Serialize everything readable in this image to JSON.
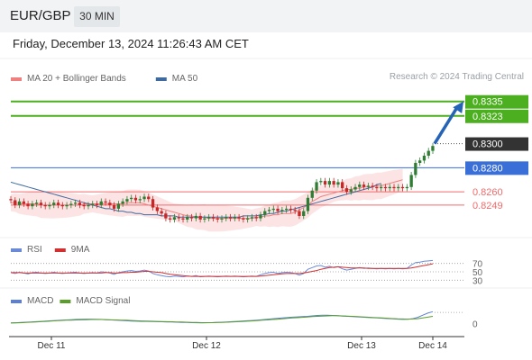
{
  "header": {
    "symbol": "EUR/GBP",
    "timeframe": "30 MIN"
  },
  "datetime": "Friday, December 13, 2024 11:26:43 AM CET",
  "credit": "Research © 2024 Trading Central",
  "colors": {
    "bull": "#2e7d32",
    "bear": "#c62828",
    "ma20": "#f08080",
    "ma50": "#3f6aa1",
    "target": "#4caf1f",
    "pivot": "#3a6fd8",
    "support": "#f06b6b",
    "current": "#333333",
    "rsi": "#6a8ad8",
    "rsi_ma": "#d32f2f",
    "macd": "#5c7fd6",
    "macd_signal": "#5a9e2a",
    "arrow": "#2463b5"
  },
  "icons": {
    "trend_arrow": "arrow-up-right-icon"
  },
  "chart_data": [
    {
      "type": "candlestick",
      "name": "price",
      "ylim": [
        0.8225,
        0.834
      ],
      "legend": [
        {
          "name": "MA 20 + Bollinger Bands",
          "color": "#f08080"
        },
        {
          "name": "MA 50",
          "color": "#3f6aa1"
        }
      ],
      "levels": [
        {
          "value": 0.8335,
          "label": "0.8335",
          "kind": "target",
          "color": "#4caf1f"
        },
        {
          "value": 0.8323,
          "label": "0.8323",
          "kind": "target",
          "color": "#4caf1f"
        },
        {
          "value": 0.83,
          "label": "0.8300",
          "kind": "current",
          "color": "#333333"
        },
        {
          "value": 0.828,
          "label": "0.8280",
          "kind": "pivot",
          "color": "#3a6fd8"
        },
        {
          "value": 0.826,
          "label": "0.8260",
          "kind": "support",
          "color": "#f06b6b"
        },
        {
          "value": 0.8249,
          "label": "0.8249",
          "kind": "support",
          "color": "#f06b6b"
        }
      ],
      "x_ticks": [
        "Dec 11",
        "Dec 12",
        "Dec 13",
        "Dec 14"
      ],
      "close": [
        0.8253,
        0.8249,
        0.8252,
        0.825,
        0.8248,
        0.825,
        0.8251,
        0.8249,
        0.8248,
        0.8249,
        0.8251,
        0.8249,
        0.8248,
        0.8249,
        0.825,
        0.8251,
        0.8249,
        0.8248,
        0.8249,
        0.825,
        0.8249,
        0.8252,
        0.8251,
        0.8249,
        0.8246,
        0.825,
        0.8252,
        0.8254,
        0.8255,
        0.8253,
        0.8254,
        0.8256,
        0.8254,
        0.8247,
        0.8244,
        0.8242,
        0.8238,
        0.8237,
        0.8239,
        0.8238,
        0.8237,
        0.8239,
        0.8238,
        0.824,
        0.8237,
        0.8238,
        0.8239,
        0.8238,
        0.8237,
        0.8238,
        0.8239,
        0.8238,
        0.8239,
        0.8238,
        0.8237,
        0.8238,
        0.8239,
        0.8238,
        0.8241,
        0.8244,
        0.8245,
        0.8246,
        0.8244,
        0.8245,
        0.8246,
        0.8245,
        0.8244,
        0.824,
        0.8244,
        0.8255,
        0.8261,
        0.8268,
        0.8269,
        0.8266,
        0.8269,
        0.8266,
        0.8268,
        0.8263,
        0.826,
        0.8262,
        0.8264,
        0.8266,
        0.8264,
        0.8265,
        0.8264,
        0.8263,
        0.8264,
        0.8263,
        0.8264,
        0.8263,
        0.8264,
        0.8263,
        0.8264,
        0.8274,
        0.8284,
        0.8286,
        0.829,
        0.8294,
        0.8298
      ],
      "ma20": [
        0.8251,
        0.8251,
        0.825,
        0.825,
        0.825,
        0.825,
        0.825,
        0.8249,
        0.8249,
        0.8249,
        0.8249,
        0.8249,
        0.8249,
        0.8249,
        0.8249,
        0.8249,
        0.8249,
        0.825,
        0.825,
        0.825,
        0.825,
        0.825,
        0.825,
        0.825,
        0.825,
        0.825,
        0.825,
        0.8251,
        0.8251,
        0.8251,
        0.8251,
        0.825,
        0.8249,
        0.8248,
        0.8247,
        0.8246,
        0.8245,
        0.8244,
        0.8243,
        0.8242,
        0.8241,
        0.824,
        0.824,
        0.8239,
        0.8239,
        0.8239,
        0.8238,
        0.8238,
        0.8238,
        0.8238,
        0.8238,
        0.8238,
        0.8238,
        0.8238,
        0.8238,
        0.8238,
        0.8238,
        0.8239,
        0.8239,
        0.824,
        0.824,
        0.8241,
        0.8241,
        0.8242,
        0.8242,
        0.8242,
        0.8243,
        0.8245,
        0.8247,
        0.8249,
        0.8252,
        0.8254,
        0.8256,
        0.8257,
        0.8258,
        0.8259,
        0.826,
        0.8261,
        0.8262,
        0.8262,
        0.8263,
        0.8263,
        0.8264,
        0.8264,
        0.8264,
        0.8265,
        0.8265,
        0.8266,
        0.8267,
        0.8268,
        0.8269,
        0.827
      ],
      "ma50": [
        0.8268,
        0.8267,
        0.8266,
        0.8265,
        0.8264,
        0.8263,
        0.8262,
        0.8261,
        0.826,
        0.8259,
        0.8258,
        0.8257,
        0.8256,
        0.8255,
        0.8254,
        0.8253,
        0.8252,
        0.8251,
        0.825,
        0.8249,
        0.8248,
        0.8247,
        0.8246,
        0.8246,
        0.8245,
        0.8244,
        0.8244,
        0.8243,
        0.8243,
        0.8242,
        0.8242,
        0.8241,
        0.8241,
        0.8241,
        0.8241,
        0.824,
        0.824,
        0.824,
        0.824,
        0.8239,
        0.8239,
        0.8239,
        0.8239,
        0.8239,
        0.8239,
        0.8239,
        0.8239,
        0.8239,
        0.8239,
        0.8239,
        0.8239,
        0.8239,
        0.8239,
        0.8239,
        0.824,
        0.824,
        0.824,
        0.824,
        0.8241,
        0.8241,
        0.8242,
        0.8242,
        0.8243,
        0.8244,
        0.8244,
        0.8245,
        0.8246,
        0.8247,
        0.8248,
        0.8249,
        0.825,
        0.8251,
        0.8252,
        0.8253,
        0.8254,
        0.8255,
        0.8256,
        0.8257,
        0.8258,
        0.8259,
        0.826,
        0.8261,
        0.8262,
        0.8263,
        0.8264,
        0.8266,
        0.8267
      ],
      "projection": {
        "from": 0.83,
        "to": 0.8335
      }
    },
    {
      "type": "line",
      "name": "RSI",
      "legend": [
        {
          "name": "RSI",
          "color": "#6a8ad8"
        },
        {
          "name": "9MA",
          "color": "#d32f2f"
        }
      ],
      "ylim": [
        20,
        80
      ],
      "levels": [
        70,
        50,
        30
      ],
      "level_labels": [
        "70",
        "50",
        "30"
      ],
      "rsi": [
        48,
        46,
        49,
        47,
        45,
        48,
        49,
        47,
        46,
        47,
        49,
        47,
        46,
        47,
        48,
        49,
        47,
        46,
        47,
        48,
        47,
        50,
        49,
        47,
        44,
        48,
        50,
        52,
        53,
        51,
        52,
        54,
        52,
        46,
        43,
        41,
        39,
        38,
        40,
        39,
        38,
        40,
        39,
        41,
        38,
        39,
        40,
        39,
        38,
        39,
        40,
        39,
        40,
        39,
        38,
        39,
        40,
        39,
        43,
        46,
        48,
        49,
        46,
        48,
        49,
        48,
        46,
        42,
        46,
        56,
        60,
        64,
        65,
        61,
        63,
        60,
        62,
        57,
        54,
        56,
        58,
        60,
        58,
        59,
        58,
        57,
        58,
        57,
        58,
        57,
        58,
        57,
        58,
        66,
        72,
        73,
        75,
        76,
        77
      ],
      "ma9": [
        48,
        48,
        48,
        47,
        47,
        47,
        47,
        47,
        47,
        47,
        47,
        47,
        47,
        47,
        47,
        47,
        47,
        47,
        47,
        47,
        47,
        47,
        48,
        48,
        47,
        47,
        48,
        48,
        49,
        49,
        50,
        51,
        51,
        50,
        49,
        48,
        46,
        44,
        43,
        42,
        41,
        40,
        39,
        39,
        39,
        39,
        39,
        39,
        39,
        39,
        39,
        39,
        39,
        39,
        39,
        39,
        39,
        39,
        40,
        41,
        42,
        43,
        44,
        45,
        46,
        46,
        46,
        46,
        47,
        49,
        51,
        53,
        56,
        58,
        60,
        61,
        62,
        61,
        60,
        59,
        59,
        59,
        59,
        58,
        58,
        58,
        58,
        58,
        58,
        58,
        58,
        58,
        58,
        59,
        61,
        63,
        65,
        67,
        69
      ]
    },
    {
      "type": "line",
      "name": "MACD",
      "legend": [
        {
          "name": "MACD",
          "color": "#5c7fd6"
        },
        {
          "name": "MACD Signal",
          "color": "#5a9e2a"
        }
      ],
      "ylim": [
        -0.0008,
        0.001
      ],
      "zero_label": "0",
      "macd": [
        5e-05,
        6e-05,
        8e-05,
        0.0001,
        0.00012,
        0.00014,
        0.00016,
        0.00018,
        0.0002,
        0.00022,
        0.00024,
        0.00026,
        0.00028,
        0.0003,
        0.00031,
        0.00032,
        0.00032,
        0.00031,
        0.0003,
        0.00028,
        0.00026,
        0.00024,
        0.00022,
        0.0002,
        0.00018,
        0.00017,
        0.00016,
        0.00016,
        0.00015,
        0.00014,
        0.00013,
        0.00012,
        0.00011,
        0.0001,
        9e-05,
        8e-05,
        7e-05,
        6e-05,
        5e-05,
        6e-05,
        7e-05,
        8e-05,
        0.0001,
        0.00012,
        0.00014,
        0.00016,
        0.00018,
        0.0002,
        0.00022,
        0.00025,
        0.00028,
        0.00031,
        0.00034,
        0.00037,
        0.0004,
        0.00043,
        0.00046,
        0.00048,
        0.0005,
        0.00052,
        0.00055,
        0.00058,
        0.0006,
        0.0006,
        0.00058,
        0.00056,
        0.00054,
        0.00052,
        0.0005,
        0.00048,
        0.00046,
        0.00044,
        0.00042,
        0.0004,
        0.00038,
        0.00036,
        0.00034,
        0.00032,
        0.0003,
        0.00031,
        0.00035,
        0.00045,
        0.0006,
        0.00075,
        0.00085
      ],
      "signal": [
        4e-05,
        5e-05,
        6e-05,
        8e-05,
        0.0001,
        0.00012,
        0.00014,
        0.00016,
        0.00018,
        0.0002,
        0.00022,
        0.00024,
        0.00025,
        0.00026,
        0.00027,
        0.00028,
        0.00029,
        0.00029,
        0.00029,
        0.00028,
        0.00027,
        0.00026,
        0.00025,
        0.00024,
        0.00022,
        0.0002,
        0.00019,
        0.00018,
        0.00017,
        0.00016,
        0.00015,
        0.00014,
        0.00013,
        0.00012,
        0.00011,
        0.0001,
        9e-05,
        8e-05,
        7e-05,
        7e-05,
        7e-05,
        8e-05,
        9e-05,
        0.0001,
        0.00012,
        0.00013,
        0.00015,
        0.00017,
        0.00019,
        0.00021,
        0.00024,
        0.00026,
        0.00029,
        0.00031,
        0.00034,
        0.00037,
        0.0004,
        0.00042,
        0.00045,
        0.00047,
        0.0005,
        0.00052,
        0.00054,
        0.00055,
        0.00056,
        0.00056,
        0.00055,
        0.00054,
        0.00052,
        0.0005,
        0.00048,
        0.00046,
        0.00044,
        0.00042,
        0.0004,
        0.00038,
        0.00036,
        0.00034,
        0.00033,
        0.00032,
        0.00033,
        0.00035,
        0.0004,
        0.00046,
        0.00052
      ]
    }
  ]
}
